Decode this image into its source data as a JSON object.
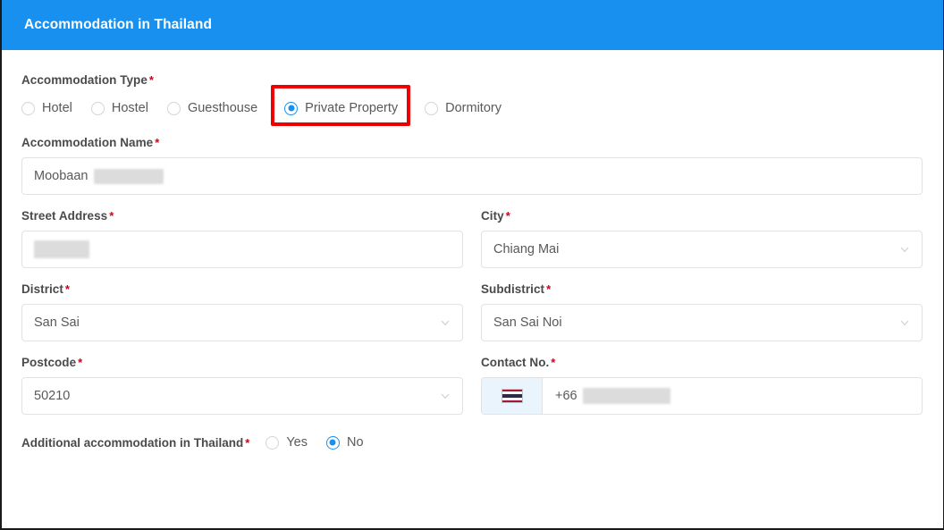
{
  "panel": {
    "title": "Accommodation in Thailand",
    "header_color": "#1890ef"
  },
  "accommodation_type": {
    "label": "Accommodation Type",
    "required_mark": "*",
    "options": [
      {
        "label": "Hotel",
        "checked": false
      },
      {
        "label": "Hostel",
        "checked": false
      },
      {
        "label": "Guesthouse",
        "checked": false
      },
      {
        "label": "Private Property",
        "checked": true
      },
      {
        "label": "Dormitory",
        "checked": false
      }
    ],
    "highlighted_option": "Private Property",
    "highlight_color": "#ee0000"
  },
  "accommodation_name": {
    "label": "Accommodation Name",
    "required_mark": "*",
    "value": "Moobaan",
    "redacted": true
  },
  "street_address": {
    "label": "Street Address",
    "required_mark": "*",
    "value": "",
    "redacted": true
  },
  "city": {
    "label": "City",
    "required_mark": "*",
    "value": "Chiang Mai",
    "icon": "chevron-down-icon"
  },
  "district": {
    "label": "District",
    "required_mark": "*",
    "value": "San Sai",
    "icon": "chevron-down-icon"
  },
  "subdistrict": {
    "label": "Subdistrict",
    "required_mark": "*",
    "value": "San Sai Noi",
    "icon": "chevron-down-icon"
  },
  "postcode": {
    "label": "Postcode",
    "required_mark": "*",
    "value": "50210",
    "icon": "chevron-down-icon"
  },
  "contact_no": {
    "label": "Contact No.",
    "required_mark": "*",
    "flag": "thailand-flag-icon",
    "dial_code": "+66",
    "number": "",
    "redacted": true
  },
  "additional_accommodation": {
    "label": "Additional accommodation in Thailand",
    "required_mark": "*",
    "options": [
      {
        "label": "Yes",
        "checked": false
      },
      {
        "label": "No",
        "checked": true
      }
    ]
  }
}
